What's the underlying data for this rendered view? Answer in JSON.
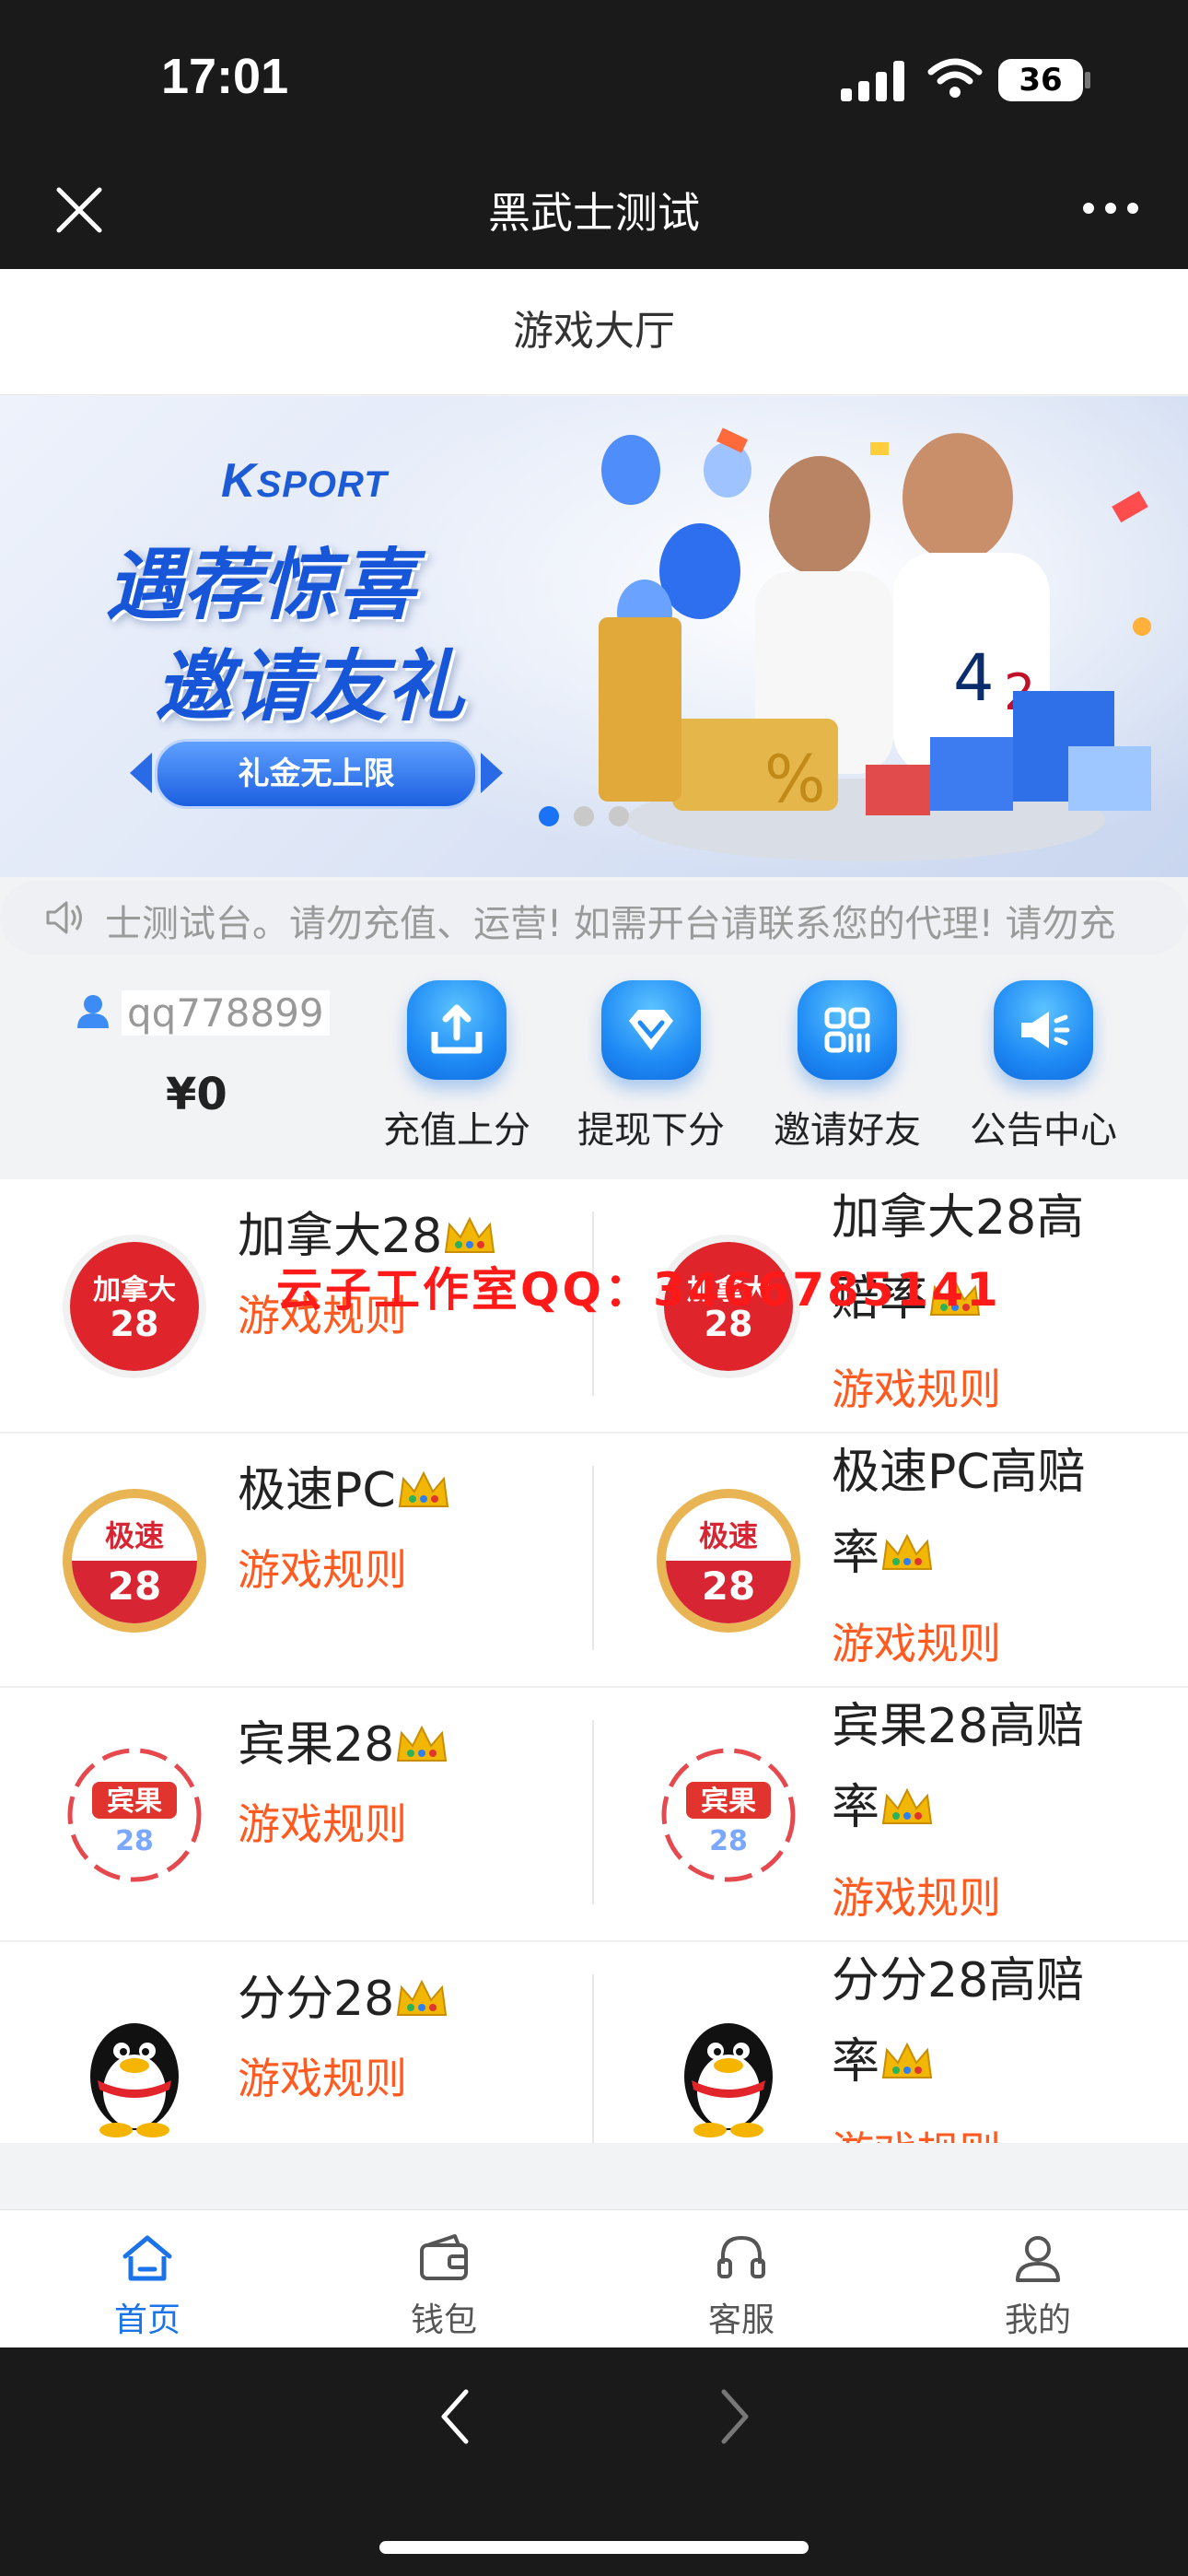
{
  "status_bar": {
    "time": "17:01",
    "battery": "36"
  },
  "nav": {
    "title": "黑武士测试"
  },
  "page": {
    "title": "游戏大厅"
  },
  "banner": {
    "brand_prefix": "K",
    "brand_suffix": "SPORT",
    "headline_1": "遇荐惊喜",
    "headline_2": "邀请友礼",
    "pill": "礼金无上限",
    "slide_count": 3,
    "active_slide": 1
  },
  "notice": {
    "text": "士测试台。请勿充值、运营! 如需开台请联系您的代理! 请勿充"
  },
  "user": {
    "username": "qq778899",
    "balance": "¥0"
  },
  "actions": [
    {
      "label": "充值上分",
      "icon": "upload-tray-icon"
    },
    {
      "label": "提现下分",
      "icon": "diamond-icon"
    },
    {
      "label": "邀请好友",
      "icon": "grid-apps-icon"
    },
    {
      "label": "公告中心",
      "icon": "megaphone-icon"
    }
  ],
  "games": [
    {
      "left": {
        "name": "加拿大28",
        "rule": "游戏规则",
        "logo": "canada28-logo"
      },
      "right": {
        "name_1": "加拿大28高",
        "name_2": "赔率",
        "rule": "游戏规则",
        "logo": "canada28-logo"
      }
    },
    {
      "left": {
        "name": "极速PC",
        "rule": "游戏规则",
        "logo": "jisu28-logo"
      },
      "right": {
        "name_1": "极速PC高赔",
        "name_2": "率",
        "rule": "游戏规则",
        "logo": "jisu28-logo"
      }
    },
    {
      "left": {
        "name": "宾果28",
        "rule": "游戏规则",
        "logo": "bingo28-logo"
      },
      "right": {
        "name_1": "宾果28高赔",
        "name_2": "率",
        "rule": "游戏规则",
        "logo": "bingo28-logo"
      }
    },
    {
      "left": {
        "name": "分分28",
        "rule": "游戏规则",
        "logo": "penguin-logo"
      },
      "right": {
        "name_1": "分分28高赔",
        "name_2": "率",
        "rule": "游戏规则",
        "logo": "penguin-logo"
      }
    }
  ],
  "watermark": "云子工作室QQ：3466785141",
  "tabbar": [
    {
      "label": "首页",
      "icon": "home-icon",
      "active": true
    },
    {
      "label": "钱包",
      "icon": "wallet-icon",
      "active": false
    },
    {
      "label": "客服",
      "icon": "headset-icon",
      "active": false
    },
    {
      "label": "我的",
      "icon": "profile-icon",
      "active": false
    }
  ],
  "colors": {
    "accent": "#1a73e8",
    "rule_text": "#ff5a1f",
    "watermark": "#ff1a1a",
    "dark_bar": "#1a1a1a"
  }
}
